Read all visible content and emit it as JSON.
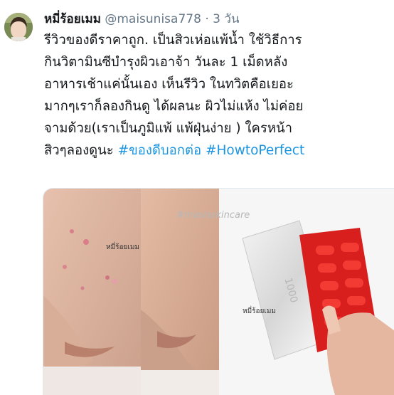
{
  "tweet": {
    "display_name": "หมี่ร้อยเมม",
    "handle": "@maisunisa778",
    "separator": "·",
    "time": "3 วัน",
    "lines": [
      "รีวิวของดีราคาถูก.  เป็นสิวเห่อแพ้น้ำ  ใช้วิธีการ",
      "กินวิตามินซีบำรุงผิวเอาจ้า วันละ 1 เม็ดหลัง",
      "อาหารเช้าแค่นั้นเอง เห็นรีวิว ในทวิตคือเยอะ",
      "มากๆเราก็ลองกินดู ได้ผลนะ ผิวไม่แห้ง ไม่ค่อย",
      "จามด้วย(เราเป็นภูมิแพ้ แพ้ฝุ่นง่าย )  ใครหน้า"
    ],
    "last_line_text": "สิวๆลองดูนะ ",
    "hashtags": [
      "#ของดีบอกต่อ",
      "#HowtoPerfect"
    ]
  },
  "media": {
    "photo_watermark_before": "หมี่ร้อยเมม",
    "photo_watermark_product": "หมี่ร้อยเมม",
    "instagram_watermark": "#masisskincare",
    "package_text": "1000"
  },
  "colors": {
    "hashtag": "#1b95e0",
    "handle": "#657786",
    "pill": "#d81a1a"
  }
}
